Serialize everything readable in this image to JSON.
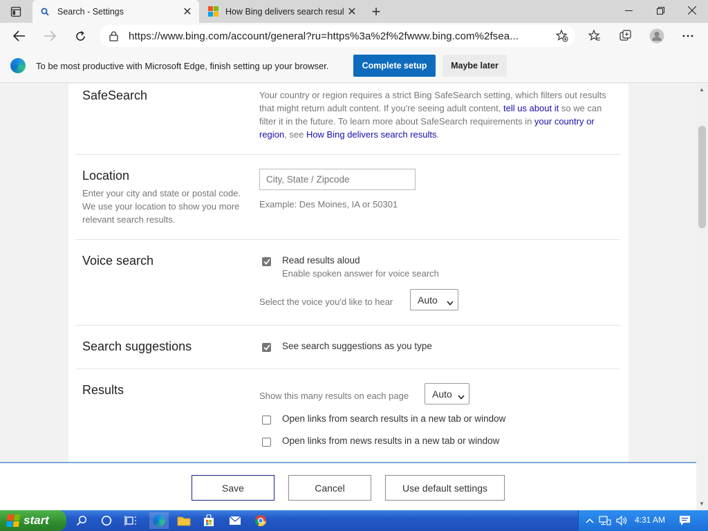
{
  "tabs": [
    {
      "title": "Search - Settings",
      "active": true,
      "icon": "search-icon"
    },
    {
      "title": "How Bing delivers search results",
      "active": false,
      "icon": "microsoft-logo-icon"
    }
  ],
  "address": {
    "url": "https://www.bing.com/account/general?ru=https%3a%2f%2fwww.bing.com%2fsea..."
  },
  "infobar": {
    "message": "To be most productive with Microsoft Edge, finish setting up your browser.",
    "primary": "Complete setup",
    "secondary": "Maybe later"
  },
  "safesearch": {
    "title": "SafeSearch",
    "text1": "Your country or region requires a strict Bing SafeSearch setting, which filters out results that might return adult content. If you're seeing adult content, ",
    "link1": "tell us about it",
    "text2": " so we can filter it in the future. To learn more about SafeSearch requirements in ",
    "link2": "your country or region",
    "text3": ", see ",
    "link3": "How Bing delivers search results",
    "text4": "."
  },
  "location": {
    "title": "Location",
    "desc": "Enter your city and state or postal code. We use your location to show you more relevant search results.",
    "placeholder": "City, State / Zipcode",
    "example": "Example: Des Moines, IA or 50301"
  },
  "voice": {
    "title": "Voice search",
    "option": "Read results aloud",
    "option_sub": "Enable spoken answer for voice search",
    "checked": true,
    "voice_label": "Select the voice you'd like to hear",
    "voice_value": "Auto"
  },
  "suggestions": {
    "title": "Search suggestions",
    "option": "See search suggestions as you type",
    "checked": true
  },
  "results": {
    "title": "Results",
    "count_label": "Show this many results on each page",
    "count_value": "Auto",
    "opt1": "Open links from search results in a new tab or window",
    "opt2": "Open links from news results in a new tab or window",
    "opt1_checked": false,
    "opt2_checked": false
  },
  "actions": {
    "save": "Save",
    "cancel": "Cancel",
    "defaults": "Use default settings"
  },
  "taskbar": {
    "start": "start",
    "time": "4:31 AM"
  },
  "colors": {
    "accent": "#0f6cbd",
    "link": "#1a0dab",
    "taskbar": "#2259c8",
    "start": "#2f8d2f"
  }
}
